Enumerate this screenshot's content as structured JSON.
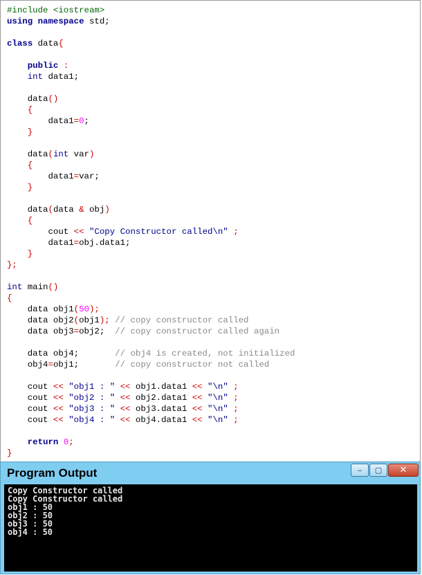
{
  "code_lines": [
    [
      {
        "t": "#include <iostream>",
        "c": "pp"
      }
    ],
    [
      {
        "t": "using",
        "c": "kw"
      },
      {
        "t": " "
      },
      {
        "t": "namespace",
        "c": "kw"
      },
      {
        "t": " std;"
      }
    ],
    [],
    [
      {
        "t": "class",
        "c": "kw"
      },
      {
        "t": " data"
      },
      {
        "t": "{",
        "c": "op"
      }
    ],
    [],
    [
      {
        "t": "    "
      },
      {
        "t": "public",
        "c": "kw"
      },
      {
        "t": " "
      },
      {
        "t": ":",
        "c": "op"
      }
    ],
    [
      {
        "t": "    "
      },
      {
        "t": "int",
        "c": "ty"
      },
      {
        "t": " data1;"
      }
    ],
    [],
    [
      {
        "t": "    data"
      },
      {
        "t": "()",
        "c": "op"
      }
    ],
    [
      {
        "t": "    "
      },
      {
        "t": "{",
        "c": "op"
      }
    ],
    [
      {
        "t": "        data1"
      },
      {
        "t": "=",
        "c": "op"
      },
      {
        "t": "0",
        "c": "num"
      },
      {
        "t": ";"
      }
    ],
    [
      {
        "t": "    "
      },
      {
        "t": "}",
        "c": "op"
      }
    ],
    [],
    [
      {
        "t": "    data"
      },
      {
        "t": "(",
        "c": "op"
      },
      {
        "t": "int",
        "c": "ty"
      },
      {
        "t": " var"
      },
      {
        "t": ")",
        "c": "op"
      }
    ],
    [
      {
        "t": "    "
      },
      {
        "t": "{",
        "c": "op"
      }
    ],
    [
      {
        "t": "        data1"
      },
      {
        "t": "=",
        "c": "op"
      },
      {
        "t": "var;"
      }
    ],
    [
      {
        "t": "    "
      },
      {
        "t": "}",
        "c": "op"
      }
    ],
    [],
    [
      {
        "t": "    data"
      },
      {
        "t": "(",
        "c": "op"
      },
      {
        "t": "data "
      },
      {
        "t": "&",
        "c": "op"
      },
      {
        "t": " obj"
      },
      {
        "t": ")",
        "c": "op"
      }
    ],
    [
      {
        "t": "    "
      },
      {
        "t": "{",
        "c": "op"
      }
    ],
    [
      {
        "t": "        cout "
      },
      {
        "t": "<<",
        "c": "op"
      },
      {
        "t": " "
      },
      {
        "t": "\"Copy Constructor called\\n\"",
        "c": "str"
      },
      {
        "t": " "
      },
      {
        "t": ";",
        "c": "op"
      }
    ],
    [
      {
        "t": "        data1"
      },
      {
        "t": "=",
        "c": "op"
      },
      {
        "t": "obj.data1;"
      }
    ],
    [
      {
        "t": "    "
      },
      {
        "t": "}",
        "c": "op"
      }
    ],
    [
      {
        "t": "};",
        "c": "op"
      }
    ],
    [],
    [
      {
        "t": "int",
        "c": "ty"
      },
      {
        "t": " main"
      },
      {
        "t": "()",
        "c": "op"
      }
    ],
    [
      {
        "t": "{",
        "c": "op"
      }
    ],
    [
      {
        "t": "    data obj1"
      },
      {
        "t": "(",
        "c": "op"
      },
      {
        "t": "50",
        "c": "num"
      },
      {
        "t": ");",
        "c": "op"
      }
    ],
    [
      {
        "t": "    data obj2"
      },
      {
        "t": "(",
        "c": "op"
      },
      {
        "t": "obj1"
      },
      {
        "t": ");",
        "c": "op"
      },
      {
        "t": " "
      },
      {
        "t": "// copy constructor called",
        "c": "cm"
      }
    ],
    [
      {
        "t": "    data obj3"
      },
      {
        "t": "=",
        "c": "op"
      },
      {
        "t": "obj2;  "
      },
      {
        "t": "// copy constructor called again",
        "c": "cm"
      }
    ],
    [],
    [
      {
        "t": "    data obj4;       "
      },
      {
        "t": "// obj4 is created, not initialized",
        "c": "cm"
      }
    ],
    [
      {
        "t": "    obj4"
      },
      {
        "t": "=",
        "c": "op"
      },
      {
        "t": "obj1;       "
      },
      {
        "t": "// copy constructor not called",
        "c": "cm"
      }
    ],
    [],
    [
      {
        "t": "    cout "
      },
      {
        "t": "<<",
        "c": "op"
      },
      {
        "t": " "
      },
      {
        "t": "\"obj1 : \"",
        "c": "str"
      },
      {
        "t": " "
      },
      {
        "t": "<<",
        "c": "op"
      },
      {
        "t": " obj1.data1 "
      },
      {
        "t": "<<",
        "c": "op"
      },
      {
        "t": " "
      },
      {
        "t": "\"\\n\"",
        "c": "str"
      },
      {
        "t": " "
      },
      {
        "t": ";",
        "c": "op"
      }
    ],
    [
      {
        "t": "    cout "
      },
      {
        "t": "<<",
        "c": "op"
      },
      {
        "t": " "
      },
      {
        "t": "\"obj2 : \"",
        "c": "str"
      },
      {
        "t": " "
      },
      {
        "t": "<<",
        "c": "op"
      },
      {
        "t": " obj2.data1 "
      },
      {
        "t": "<<",
        "c": "op"
      },
      {
        "t": " "
      },
      {
        "t": "\"\\n\"",
        "c": "str"
      },
      {
        "t": " "
      },
      {
        "t": ";",
        "c": "op"
      }
    ],
    [
      {
        "t": "    cout "
      },
      {
        "t": "<<",
        "c": "op"
      },
      {
        "t": " "
      },
      {
        "t": "\"obj3 : \"",
        "c": "str"
      },
      {
        "t": " "
      },
      {
        "t": "<<",
        "c": "op"
      },
      {
        "t": " obj3.data1 "
      },
      {
        "t": "<<",
        "c": "op"
      },
      {
        "t": " "
      },
      {
        "t": "\"\\n\"",
        "c": "str"
      },
      {
        "t": " "
      },
      {
        "t": ";",
        "c": "op"
      }
    ],
    [
      {
        "t": "    cout "
      },
      {
        "t": "<<",
        "c": "op"
      },
      {
        "t": " "
      },
      {
        "t": "\"obj4 : \"",
        "c": "str"
      },
      {
        "t": " "
      },
      {
        "t": "<<",
        "c": "op"
      },
      {
        "t": " obj4.data1 "
      },
      {
        "t": "<<",
        "c": "op"
      },
      {
        "t": " "
      },
      {
        "t": "\"\\n\"",
        "c": "str"
      },
      {
        "t": " "
      },
      {
        "t": ";",
        "c": "op"
      }
    ],
    [],
    [
      {
        "t": "    "
      },
      {
        "t": "return",
        "c": "kw"
      },
      {
        "t": " "
      },
      {
        "t": "0",
        "c": "num"
      },
      {
        "t": ";",
        "c": "op"
      }
    ],
    [
      {
        "t": "}",
        "c": "op"
      }
    ]
  ],
  "output_window": {
    "title": "Program Output",
    "minimize_glyph": "‒",
    "maximize_glyph": "▢",
    "close_glyph": "✕",
    "lines": [
      "Copy Constructor called",
      "Copy Constructor called",
      "obj1 : 50",
      "obj2 : 50",
      "obj3 : 50",
      "obj4 : 50"
    ]
  },
  "colors": {
    "keyword": "#00008b",
    "preprocessor": "#006400",
    "operator": "#cc0000",
    "number": "#ff00ff",
    "comment": "#8a8a8a",
    "titlebar": "#7fcdf0",
    "console_bg": "#000000"
  }
}
